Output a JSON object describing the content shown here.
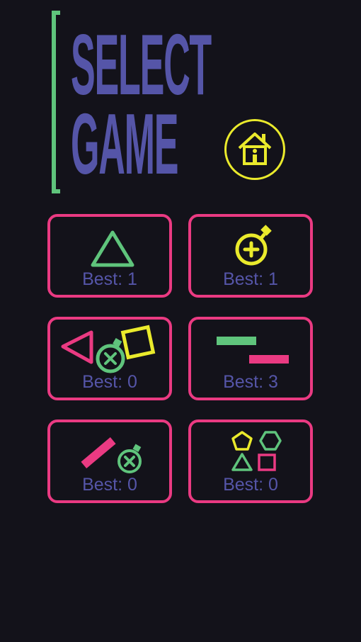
{
  "title": {
    "line1": "SELECT",
    "line2": "GAME"
  },
  "games": [
    {
      "best_label": "Best: 1"
    },
    {
      "best_label": "Best: 1"
    },
    {
      "best_label": "Best: 0"
    },
    {
      "best_label": "Best: 3"
    },
    {
      "best_label": "Best: 0"
    },
    {
      "best_label": "Best: 0"
    }
  ],
  "colors": {
    "background": "#13121a",
    "title": "#5555a8",
    "accent_green": "#5fc47c",
    "card_border": "#ea3a82",
    "yellow": "#eaea2c"
  }
}
